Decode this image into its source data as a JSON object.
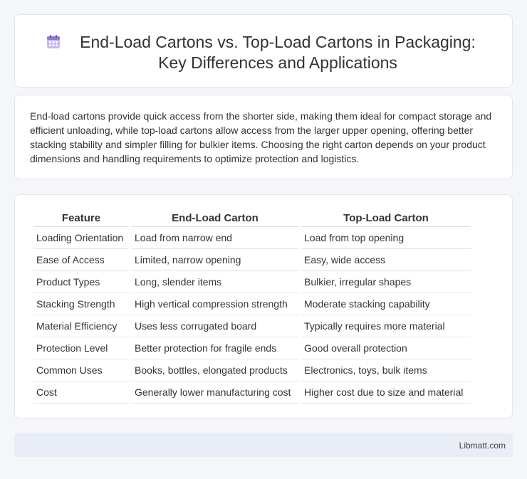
{
  "header": {
    "title": "End-Load Cartons vs. Top-Load Cartons in Packaging: Key Differences and Applications",
    "icon": "calendar-icon"
  },
  "intro": {
    "text": "End-load cartons provide quick access from the shorter side, making them ideal for compact storage and efficient unloading, while top-load cartons allow access from the larger upper opening, offering better stacking stability and simpler filling for bulkier items. Choosing the right carton depends on your product dimensions and handling requirements to optimize protection and logistics."
  },
  "table": {
    "headers": [
      "Feature",
      "End-Load Carton",
      "Top-Load Carton"
    ],
    "rows": [
      [
        "Loading Orientation",
        "Load from narrow end",
        "Load from top opening"
      ],
      [
        "Ease of Access",
        "Limited, narrow opening",
        "Easy, wide access"
      ],
      [
        "Product Types",
        "Long, slender items",
        "Bulkier, irregular shapes"
      ],
      [
        "Stacking Strength",
        "High vertical compression strength",
        "Moderate stacking capability"
      ],
      [
        "Material Efficiency",
        "Uses less corrugated board",
        "Typically requires more material"
      ],
      [
        "Protection Level",
        "Better protection for fragile ends",
        "Good overall protection"
      ],
      [
        "Common Uses",
        "Books, bottles, elongated products",
        "Electronics, toys, bulk items"
      ],
      [
        "Cost",
        "Generally lower manufacturing cost",
        "Higher cost due to size and material"
      ]
    ]
  },
  "footer": {
    "text": "Libmatt.com"
  }
}
